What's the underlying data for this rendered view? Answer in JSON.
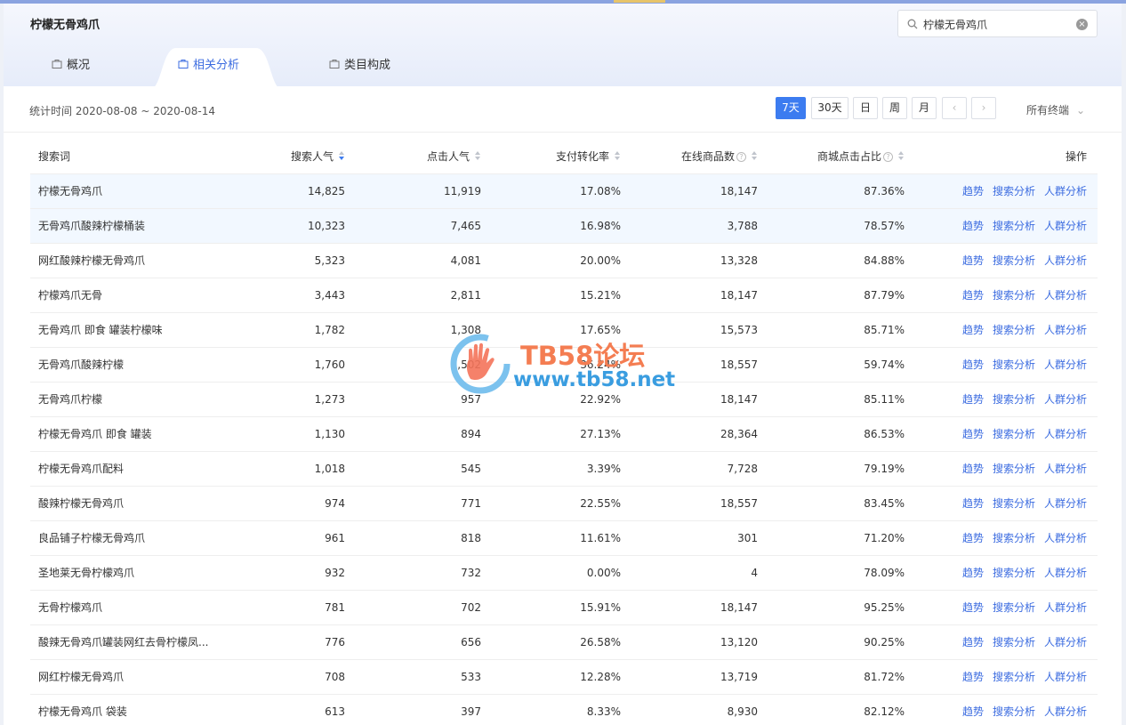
{
  "header": {
    "title": "柠檬无骨鸡爪",
    "search": {
      "value": "柠檬无骨鸡爪",
      "clear_label": "×"
    }
  },
  "tabs": [
    {
      "label": "概况",
      "icon": "bag-icon"
    },
    {
      "label": "相关分析",
      "icon": "bag-icon",
      "active": true
    },
    {
      "label": "类目构成",
      "icon": "bag-icon"
    }
  ],
  "statbar": {
    "time_label": "统计时间 2020-08-08 ~ 2020-08-14",
    "ranges": [
      "7天",
      "30天",
      "日",
      "周",
      "月"
    ],
    "active_range": "7天",
    "prev_label": "‹",
    "next_label": "›",
    "terminal": "所有终端",
    "terminal_chevron": "⌄"
  },
  "table": {
    "columns": [
      "搜索词",
      "搜索人气",
      "点击人气",
      "支付转化率",
      "在线商品数",
      "商城点击占比",
      "操作"
    ],
    "help_mark": "?",
    "ops": [
      "趋势",
      "搜索分析",
      "人群分析"
    ],
    "rows": [
      {
        "kw": "柠檬无骨鸡爪",
        "search": "14,825",
        "click": "11,919",
        "conv": "17.08%",
        "items": "18,147",
        "mall": "87.36%"
      },
      {
        "kw": "无骨鸡爪酸辣柠檬桶装",
        "search": "10,323",
        "click": "7,465",
        "conv": "16.98%",
        "items": "3,788",
        "mall": "78.57%"
      },
      {
        "kw": "网红酸辣柠檬无骨鸡爪",
        "search": "5,323",
        "click": "4,081",
        "conv": "20.00%",
        "items": "13,328",
        "mall": "84.88%"
      },
      {
        "kw": "柠檬鸡爪无骨",
        "search": "3,443",
        "click": "2,811",
        "conv": "15.21%",
        "items": "18,147",
        "mall": "87.79%"
      },
      {
        "kw": "无骨鸡爪 即食 罐装柠檬味",
        "search": "1,782",
        "click": "1,308",
        "conv": "17.65%",
        "items": "15,573",
        "mall": "85.71%"
      },
      {
        "kw": "无骨鸡爪酸辣柠檬",
        "search": "1,760",
        "click": "1,502",
        "conv": "36.24%",
        "items": "18,557",
        "mall": "59.74%"
      },
      {
        "kw": "无骨鸡爪柠檬",
        "search": "1,273",
        "click": "957",
        "conv": "22.92%",
        "items": "18,147",
        "mall": "85.11%"
      },
      {
        "kw": "柠檬无骨鸡爪 即食 罐装",
        "search": "1,130",
        "click": "894",
        "conv": "27.13%",
        "items": "28,364",
        "mall": "86.53%"
      },
      {
        "kw": "柠檬无骨鸡爪配料",
        "search": "1,018",
        "click": "545",
        "conv": "3.39%",
        "items": "7,728",
        "mall": "79.19%"
      },
      {
        "kw": "酸辣柠檬无骨鸡爪",
        "search": "974",
        "click": "771",
        "conv": "22.55%",
        "items": "18,557",
        "mall": "83.45%"
      },
      {
        "kw": "良品铺子柠檬无骨鸡爪",
        "search": "961",
        "click": "818",
        "conv": "11.61%",
        "items": "301",
        "mall": "71.20%"
      },
      {
        "kw": "圣地莱无骨柠檬鸡爪",
        "search": "932",
        "click": "732",
        "conv": "0.00%",
        "items": "4",
        "mall": "78.09%"
      },
      {
        "kw": "无骨柠檬鸡爪",
        "search": "781",
        "click": "702",
        "conv": "15.91%",
        "items": "18,147",
        "mall": "95.25%"
      },
      {
        "kw": "酸辣无骨鸡爪罐装网红去骨柠檬凤...",
        "search": "776",
        "click": "656",
        "conv": "26.58%",
        "items": "13,120",
        "mall": "90.25%"
      },
      {
        "kw": "网红柠檬无骨鸡爪",
        "search": "708",
        "click": "533",
        "conv": "12.28%",
        "items": "13,719",
        "mall": "81.72%"
      },
      {
        "kw": "柠檬无骨鸡爪 袋装",
        "search": "613",
        "click": "397",
        "conv": "8.33%",
        "items": "8,930",
        "mall": "82.12%"
      }
    ]
  },
  "watermark": {
    "title": "TB58论坛",
    "url": "www.tb58.net"
  },
  "colors": {
    "accent": "#3c7cf0",
    "link": "#3c6ce0",
    "watermark_orange": "#f47d52",
    "watermark_blue": "#3a9de0"
  }
}
